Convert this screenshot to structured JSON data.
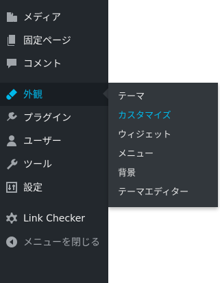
{
  "menu": [
    {
      "label": "メディア",
      "icon": "media-icon"
    },
    {
      "label": "固定ページ",
      "icon": "pages-icon"
    },
    {
      "label": "コメント",
      "icon": "comments-icon"
    },
    {
      "label": "外観",
      "icon": "appearance-icon",
      "active": true
    },
    {
      "label": "プラグイン",
      "icon": "plugins-icon"
    },
    {
      "label": "ユーザー",
      "icon": "users-icon"
    },
    {
      "label": "ツール",
      "icon": "tools-icon"
    },
    {
      "label": "設定",
      "icon": "settings-icon"
    },
    {
      "label": "Link Checker",
      "icon": "gear-icon"
    },
    {
      "label": "メニューを閉じる",
      "icon": "collapse-icon"
    }
  ],
  "submenu": [
    {
      "label": "テーマ"
    },
    {
      "label": "カスタマイズ",
      "current": true
    },
    {
      "label": "ウィジェット"
    },
    {
      "label": "メニュー"
    },
    {
      "label": "背景"
    },
    {
      "label": "テーマエディター"
    }
  ],
  "colors": {
    "sidebar_bg": "#23282d",
    "active_bg": "#191e23",
    "flyout_bg": "#32373c",
    "accent": "#00b9eb",
    "text": "#eeeeee",
    "icon": "#a0a5aa"
  }
}
